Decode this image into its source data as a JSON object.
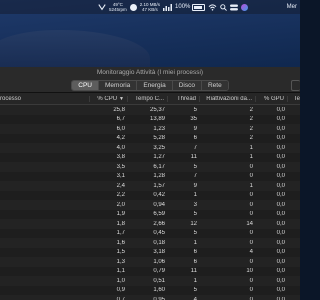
{
  "menubar": {
    "temp": "49°C",
    "fan": "5245rpm",
    "stat1": "2.10 MB/s",
    "stat2": "47 KB/s",
    "battery_pct": "100%",
    "day": "Mer"
  },
  "window": {
    "title": "Monitoraggio Attività (I miei processi)",
    "tabs": [
      "CPU",
      "Memoria",
      "Energia",
      "Disco",
      "Rete"
    ],
    "active_tab": "CPU"
  },
  "columns": {
    "name": "rocesso",
    "cpu": "% CPU",
    "tempo": "Tempo C...",
    "thread": "Thread",
    "riattivazioni": "Riattivazioni da...",
    "gpu": "% GPU",
    "last": "Te"
  },
  "rows": [
    {
      "cpu": "25,8",
      "tempo": "25,37",
      "thread": "5",
      "riat": "2",
      "gpu": "0,0"
    },
    {
      "cpu": "6,7",
      "tempo": "13,89",
      "thread": "35",
      "riat": "2",
      "gpu": "0,0"
    },
    {
      "cpu": "6,0",
      "tempo": "1,23",
      "thread": "9",
      "riat": "2",
      "gpu": "0,0"
    },
    {
      "cpu": "4,2",
      "tempo": "5,28",
      "thread": "6",
      "riat": "2",
      "gpu": "0,0"
    },
    {
      "cpu": "4,0",
      "tempo": "3,25",
      "thread": "7",
      "riat": "1",
      "gpu": "0,0"
    },
    {
      "cpu": "3,8",
      "tempo": "1,27",
      "thread": "11",
      "riat": "1",
      "gpu": "0,0"
    },
    {
      "cpu": "3,5",
      "tempo": "6,17",
      "thread": "5",
      "riat": "0",
      "gpu": "0,0"
    },
    {
      "cpu": "3,1",
      "tempo": "1,28",
      "thread": "7",
      "riat": "0",
      "gpu": "0,0"
    },
    {
      "cpu": "2,4",
      "tempo": "1,57",
      "thread": "9",
      "riat": "1",
      "gpu": "0,0"
    },
    {
      "cpu": "2,2",
      "tempo": "0,42",
      "thread": "1",
      "riat": "0",
      "gpu": "0,0"
    },
    {
      "cpu": "2,0",
      "tempo": "0,94",
      "thread": "3",
      "riat": "0",
      "gpu": "0,0"
    },
    {
      "cpu": "1,9",
      "tempo": "6,59",
      "thread": "5",
      "riat": "0",
      "gpu": "0,0"
    },
    {
      "cpu": "1,8",
      "tempo": "2,66",
      "thread": "12",
      "riat": "14",
      "gpu": "0,0"
    },
    {
      "cpu": "1,7",
      "tempo": "0,45",
      "thread": "5",
      "riat": "0",
      "gpu": "0,0"
    },
    {
      "cpu": "1,6",
      "tempo": "0,18",
      "thread": "1",
      "riat": "0",
      "gpu": "0,0"
    },
    {
      "cpu": "1,5",
      "tempo": "3,18",
      "thread": "6",
      "riat": "4",
      "gpu": "0,0"
    },
    {
      "cpu": "1,3",
      "tempo": "1,06",
      "thread": "6",
      "riat": "0",
      "gpu": "0,0"
    },
    {
      "cpu": "1,1",
      "tempo": "0,79",
      "thread": "11",
      "riat": "10",
      "gpu": "0,0"
    },
    {
      "cpu": "1,0",
      "tempo": "0,51",
      "thread": "1",
      "riat": "0",
      "gpu": "0,0"
    },
    {
      "cpu": "0,9",
      "tempo": "1,60",
      "thread": "5",
      "riat": "0",
      "gpu": "0,0"
    },
    {
      "cpu": "0,7",
      "tempo": "0,95",
      "thread": "4",
      "riat": "0",
      "gpu": "0,0"
    }
  ]
}
